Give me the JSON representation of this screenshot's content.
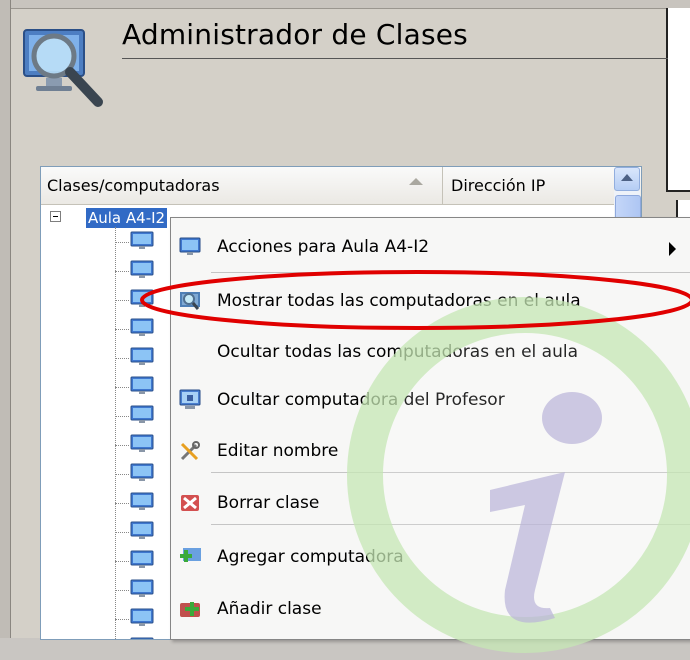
{
  "app": {
    "title": "Administrador de Clases"
  },
  "tree": {
    "columns": [
      {
        "label": "Clases/computadoras"
      },
      {
        "label": "Dirección IP"
      }
    ],
    "root_item": {
      "label": "Aula A4-I2",
      "expanded": true
    },
    "child_count": 15,
    "child_icon": "monitor-icon"
  },
  "context_menu": {
    "items": [
      {
        "label": "Acciones para Aula A4-I2",
        "icon": "monitor-icon",
        "has_submenu": true
      },
      {
        "label": "Mostrar todas las computadoras en el aula",
        "icon": "search-monitor-icon",
        "highlighted": true
      },
      {
        "label": "Ocultar todas las computadoras en el aula",
        "icon": ""
      },
      {
        "label": "Ocultar computadora del Profesor",
        "icon": "teacher-pc-icon"
      },
      {
        "label": "Editar nombre",
        "icon": "tools-icon"
      },
      {
        "label": "Borrar clase",
        "icon": "delete-icon"
      },
      {
        "label": "Agregar computadora",
        "icon": "add-computer-icon"
      },
      {
        "label": "Añadir clase",
        "icon": "add-class-icon"
      }
    ]
  },
  "colors": {
    "selection": "#316ac5",
    "highlight_outline": "#e00000",
    "watermark": "#b7e0a6"
  }
}
